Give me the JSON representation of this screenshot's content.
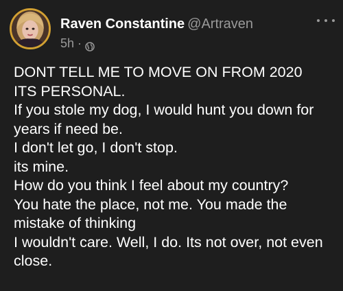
{
  "author": {
    "display_name": "Raven Constantine",
    "handle": "@Artraven",
    "avatar_icon": "avatar-photo"
  },
  "meta": {
    "time": "5h",
    "separator": "·",
    "visibility_icon": "globe-icon"
  },
  "more_menu_icon": "more-options-icon",
  "post": {
    "lines": [
      "DONT TELL ME TO MOVE ON FROM 2020",
      "ITS PERSONAL.",
      "If you stole my dog, I would hunt you down for",
      "years if need be.",
      "I don't let go, I don't stop.",
      "its mine.",
      "How do you think I feel about my country?",
      "You hate the place, not me. You made the",
      "mistake of thinking",
      "I wouldn't care. Well, I do. Its not over, not even",
      "close."
    ]
  },
  "colors": {
    "background": "#1e1e1e",
    "text": "#ffffff",
    "muted": "#9a9a9a",
    "avatar_ring": "#d2a032"
  }
}
